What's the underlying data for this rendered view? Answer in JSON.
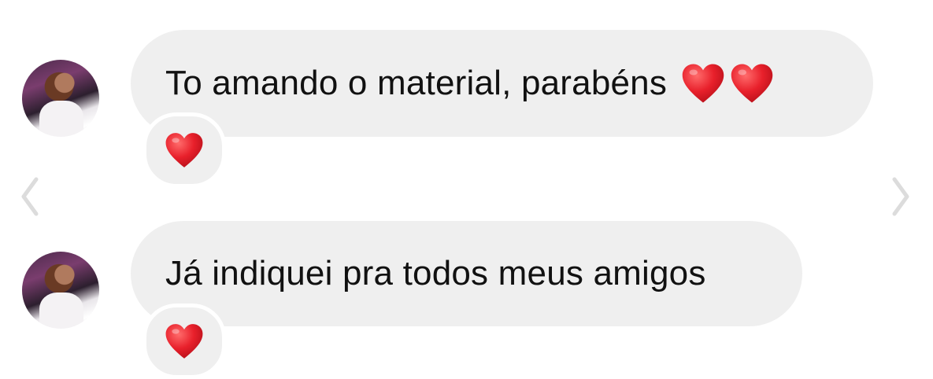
{
  "messages": [
    {
      "text": "To amando o material, parabéns",
      "trailing_emoji": [
        "heart",
        "heart"
      ],
      "reaction": "heart"
    },
    {
      "text": "Já indiquei pra todos meus amigos",
      "trailing_emoji": [],
      "reaction": "heart"
    }
  ],
  "colors": {
    "bubble": "#efefef",
    "heart": "#e8202b",
    "chevron": "#dcdcdc",
    "background": "#ffffff"
  },
  "icons": {
    "prev": "chevron-left-icon",
    "next": "chevron-right-icon",
    "reaction": "heart-icon"
  }
}
